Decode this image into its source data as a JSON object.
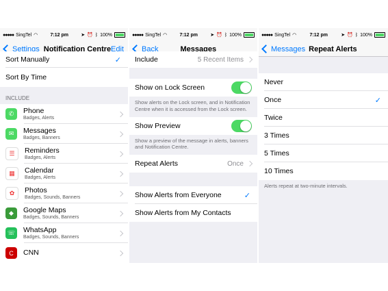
{
  "status": {
    "carrier": "SingTel",
    "time": "7:12 pm",
    "battery": "100%"
  },
  "panel1": {
    "back": "Settings",
    "title": "Notification Centre",
    "edit": "Edit",
    "sort_manual": "Sort Manually",
    "sort_time": "Sort By Time",
    "include_header": "INCLUDE",
    "apps": [
      {
        "name": "Phone",
        "sub": "Badges, Alerts",
        "color": "#4cd964",
        "glyph": "✆"
      },
      {
        "name": "Messages",
        "sub": "Badges, Banners",
        "color": "#4cd964",
        "glyph": "✉"
      },
      {
        "name": "Reminders",
        "sub": "Badges, Alerts",
        "color": "#ffffff",
        "glyph": "☰"
      },
      {
        "name": "Calendar",
        "sub": "Badges, Alerts",
        "color": "#ffffff",
        "glyph": "▦"
      },
      {
        "name": "Photos",
        "sub": "Badges, Sounds, Banners",
        "color": "#ffffff",
        "glyph": "✿"
      },
      {
        "name": "Google Maps",
        "sub": "Badges, Sounds, Banners",
        "color": "#3a9b3a",
        "glyph": "◆"
      },
      {
        "name": "WhatsApp",
        "sub": "Badges, Sounds, Banners",
        "color": "#25c05a",
        "glyph": "☏"
      },
      {
        "name": "CNN",
        "sub": "",
        "color": "#cc0000",
        "glyph": "C"
      }
    ]
  },
  "panel2": {
    "back": "Back",
    "title": "Messages",
    "include_label": "Include",
    "include_value": "5 Recent Items",
    "lock_label": "Show on Lock Screen",
    "lock_foot": "Show alerts on the Lock screen, and in Notification Centre when it is accessed from the Lock screen.",
    "preview_label": "Show Preview",
    "preview_foot": "Show a preview of the message in alerts, banners and Notification Centre.",
    "repeat_label": "Repeat Alerts",
    "repeat_value": "Once",
    "from_everyone": "Show Alerts from Everyone",
    "from_contacts": "Show Alerts from My Contacts"
  },
  "panel3": {
    "back": "Messages",
    "title": "Repeat Alerts",
    "options": [
      "Never",
      "Once",
      "Twice",
      "3 Times",
      "5 Times",
      "10 Times"
    ],
    "selected": "Once",
    "foot": "Alerts repeat at two-minute intervals."
  }
}
